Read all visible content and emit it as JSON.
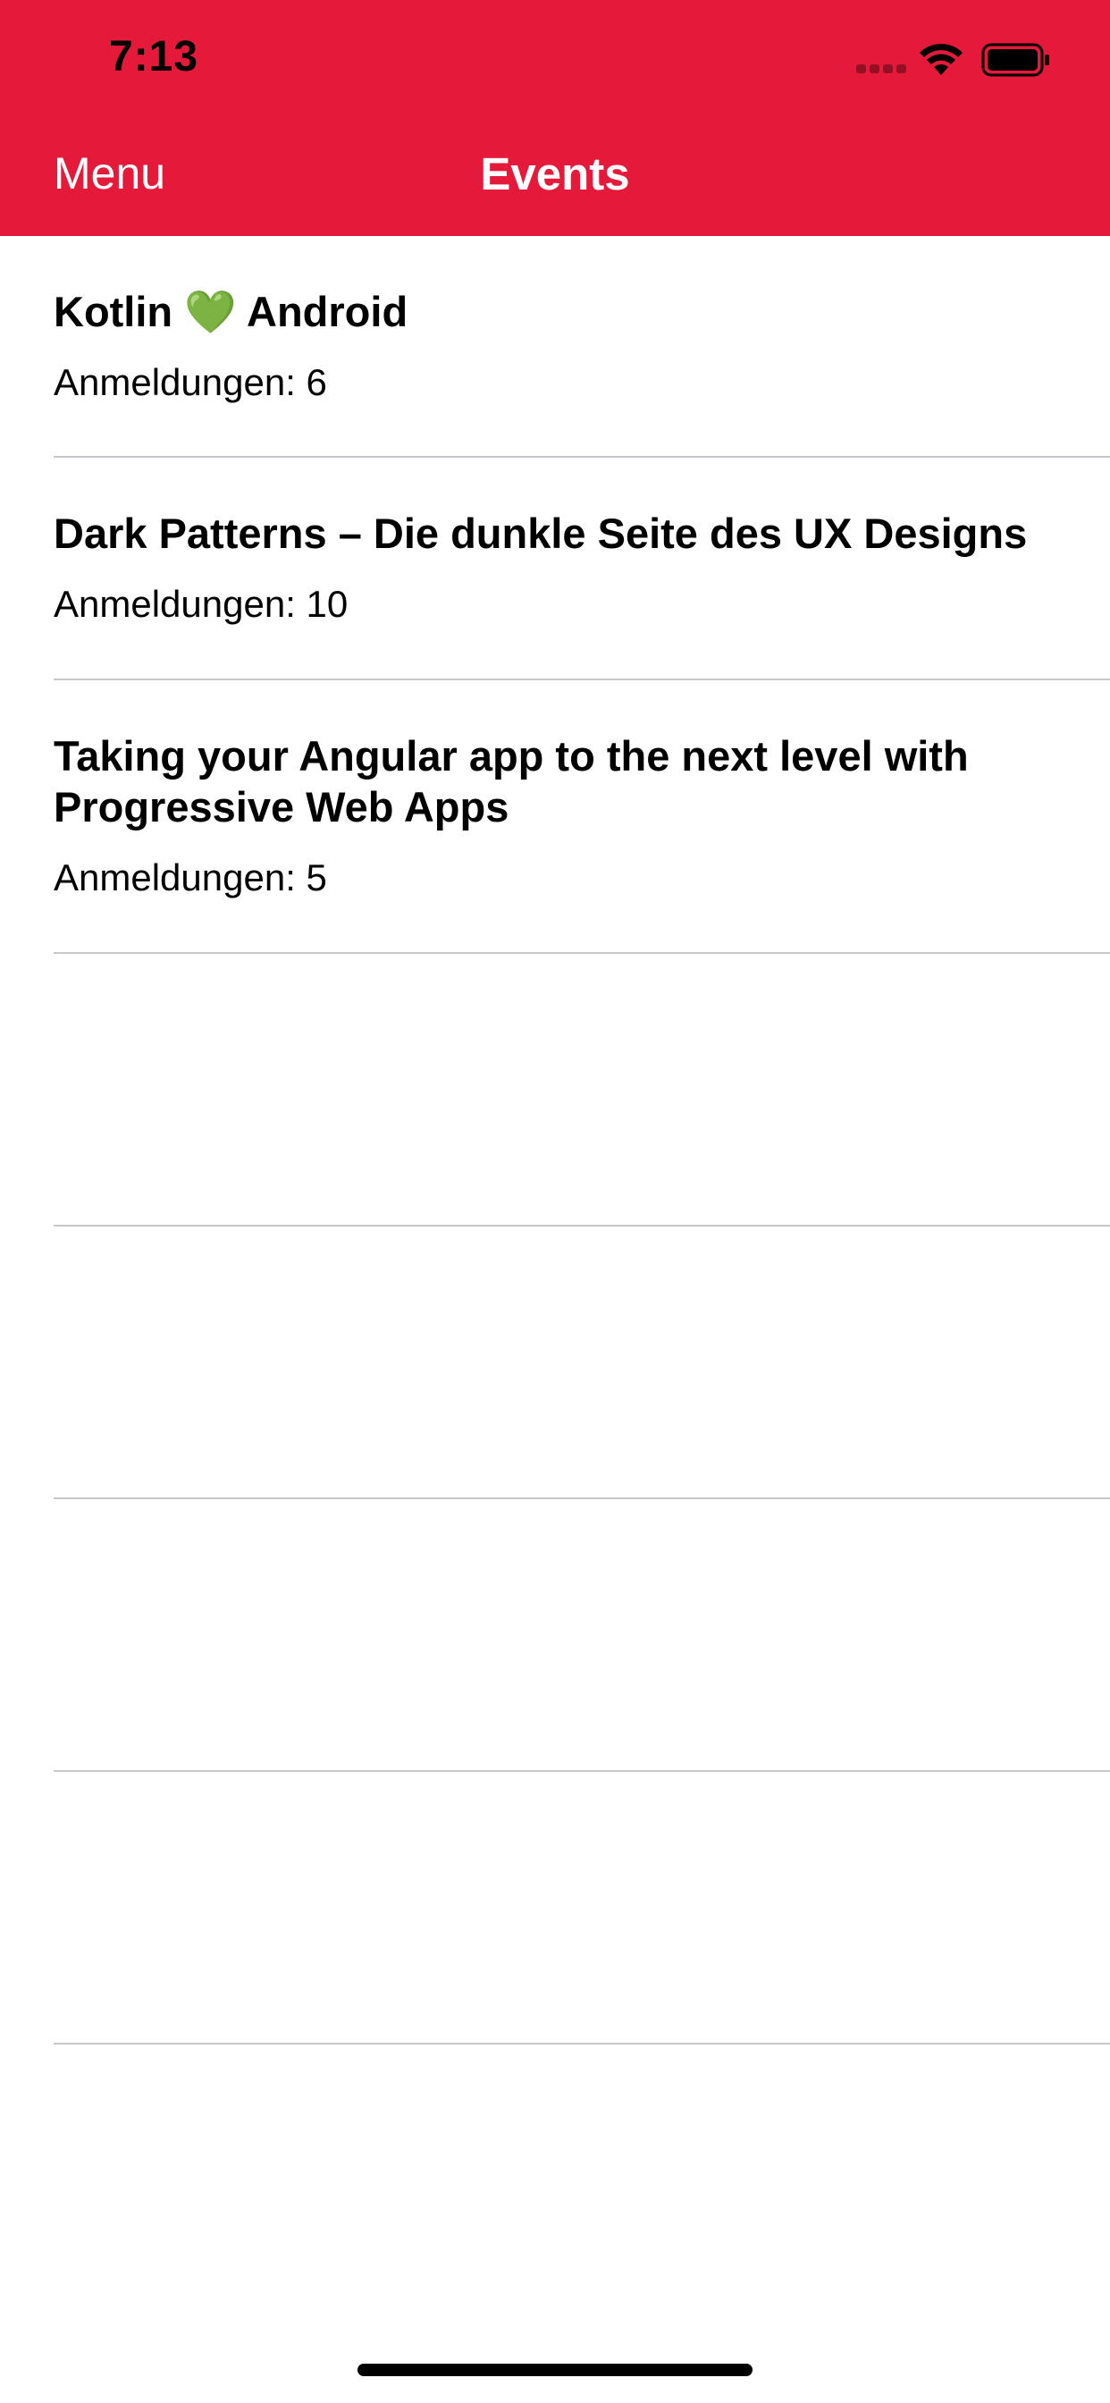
{
  "status_bar": {
    "time": "7:13"
  },
  "nav": {
    "left_button": "Menu",
    "title": "Events"
  },
  "events": [
    {
      "title": "Kotlin 💚 Android",
      "registrations": "Anmeldungen: 6"
    },
    {
      "title": "Dark Patterns – Die dunkle Seite des UX Designs",
      "registrations": "Anmeldungen: 10"
    },
    {
      "title": "Taking your Angular app to the next level with Progressive Web Apps",
      "registrations": "Anmeldungen: 5"
    }
  ],
  "colors": {
    "accent": "#e5193a",
    "separator": "#c8c8cc"
  }
}
